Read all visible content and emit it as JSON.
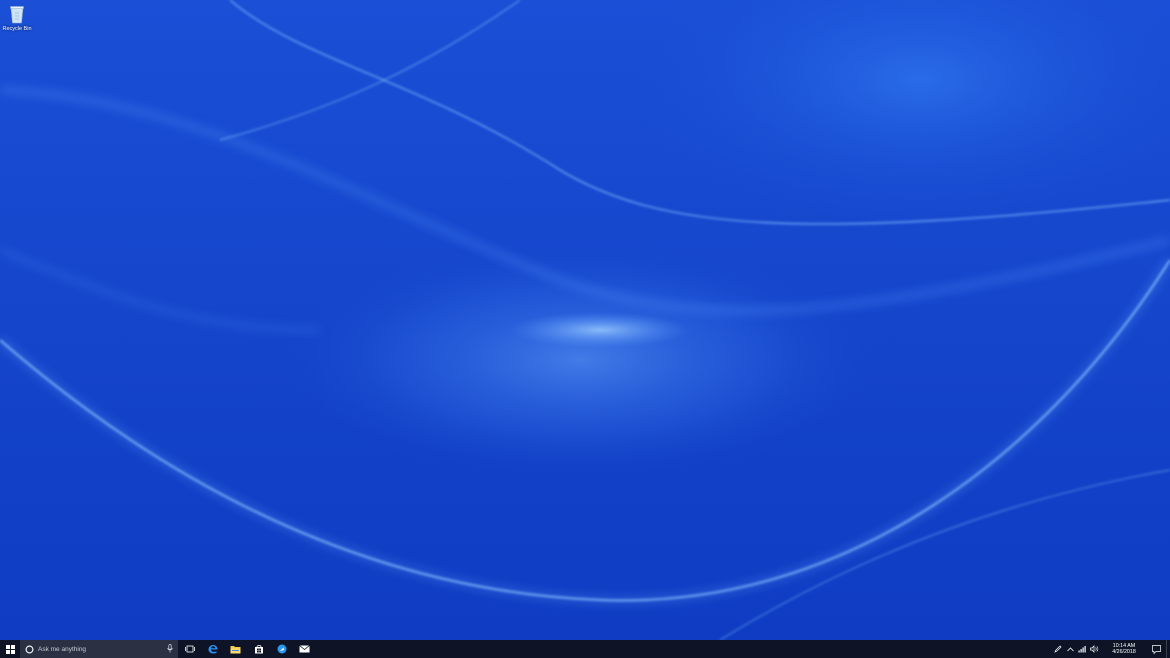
{
  "desktop": {
    "icons": [
      {
        "label": "Recycle Bin",
        "icon": "recycle-bin-icon"
      }
    ],
    "wallpaper": {
      "base_color": "#1546cc",
      "highlight_color": "#6fb0ff"
    }
  },
  "taskbar": {
    "background": "#0e1425",
    "start": {
      "icon": "windows-logo-icon"
    },
    "search": {
      "placeholder": "Ask me anything",
      "icon": "cortana-icon",
      "mic_icon": "microphone-icon"
    },
    "buttons": [
      {
        "icon": "task-view-icon"
      },
      {
        "icon": "edge-icon"
      },
      {
        "icon": "file-explorer-icon"
      },
      {
        "icon": "store-icon"
      },
      {
        "icon": "web-icon"
      },
      {
        "icon": "mail-icon"
      }
    ],
    "tray": {
      "icons": [
        "pen-ink-icon",
        "chevron-up-icon",
        "network-icon",
        "volume-icon"
      ],
      "time": "10:14 AM",
      "date": "4/26/2018",
      "action_center_icon": "action-center-icon"
    }
  }
}
